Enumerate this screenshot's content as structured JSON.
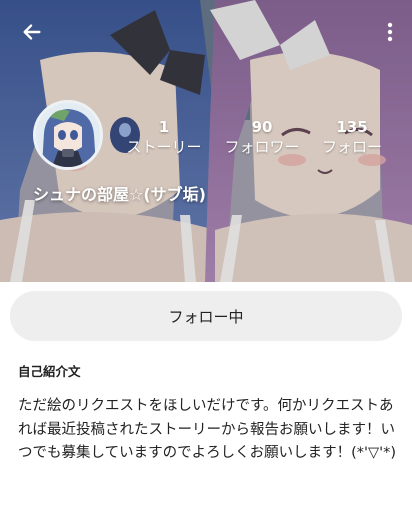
{
  "header": {
    "back_icon": "arrow-left-icon",
    "more_icon": "more-vertical-icon"
  },
  "profile": {
    "username": "シュナの部屋☆(サブ垢)",
    "stats": {
      "stories": {
        "count": "1",
        "label": "ストーリー"
      },
      "followers": {
        "count": "90",
        "label": "フォロワー"
      },
      "following": {
        "count": "135",
        "label": "フォロー"
      }
    }
  },
  "actions": {
    "follow_button_label": "フォロー中"
  },
  "bio": {
    "heading": "自己紹介文",
    "text": "ただ絵のリクエストをほしいだけです。何かリクエストあれば最近投稿されたストーリーから報告お願いします！いつでも募集していますのでよろしくお願いします！(*'▽'*)"
  },
  "colors": {
    "button_bg": "#eeeeee",
    "text": "#222222",
    "overlay_text": "#ffffff"
  }
}
